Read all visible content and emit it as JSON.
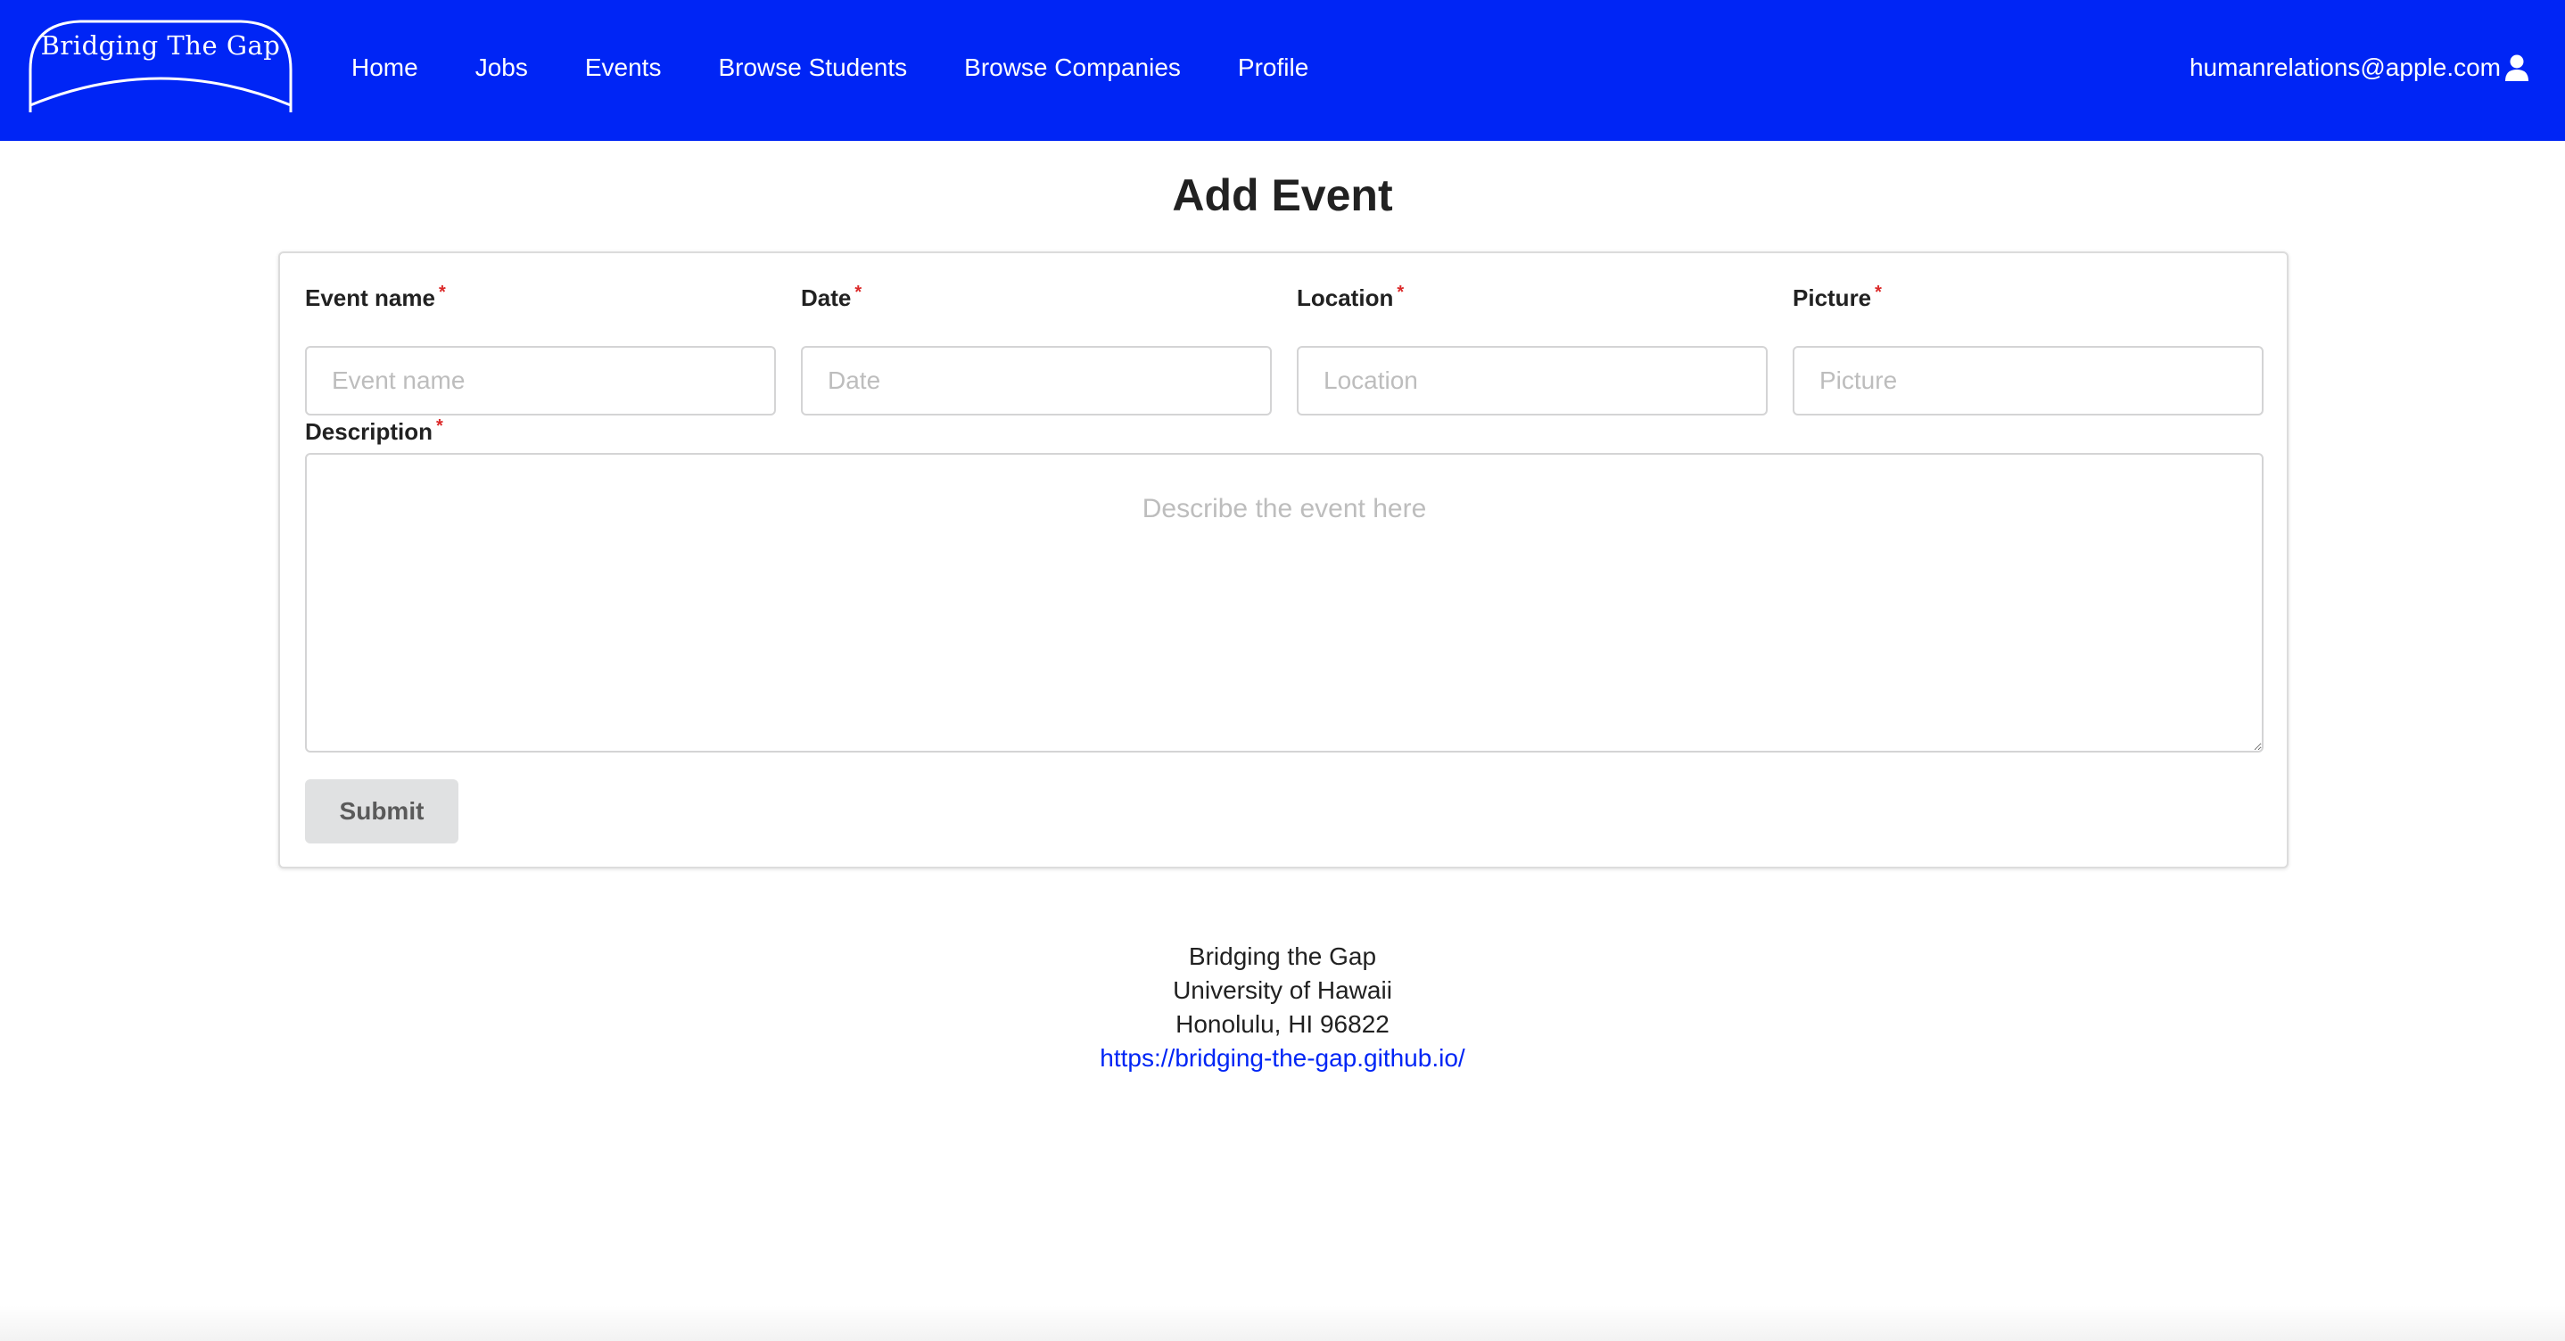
{
  "nav": {
    "logo_text": "Bridging The Gap",
    "items": [
      {
        "label": "Home"
      },
      {
        "label": "Jobs"
      },
      {
        "label": "Events"
      },
      {
        "label": "Browse Students"
      },
      {
        "label": "Browse Companies"
      },
      {
        "label": "Profile"
      }
    ],
    "user_email": "humanrelations@apple.com",
    "user_icon": "user-icon",
    "background_color": "#0025f5"
  },
  "page": {
    "title": "Add Event"
  },
  "form": {
    "fields": [
      {
        "label": "Event name",
        "required": "*",
        "placeholder": "Event name"
      },
      {
        "label": "Date",
        "required": "*",
        "placeholder": "Date"
      },
      {
        "label": "Location",
        "required": "*",
        "placeholder": "Location"
      },
      {
        "label": "Picture",
        "required": "*",
        "placeholder": "Picture"
      }
    ],
    "description": {
      "label": "Description",
      "required": "*",
      "placeholder": "Describe the event here"
    },
    "submit_label": "Submit"
  },
  "footer": {
    "line1": "Bridging the Gap",
    "line2": "University of Hawaii",
    "line3": "Honolulu, HI 96822",
    "link": "https://bridging-the-gap.github.io/"
  }
}
